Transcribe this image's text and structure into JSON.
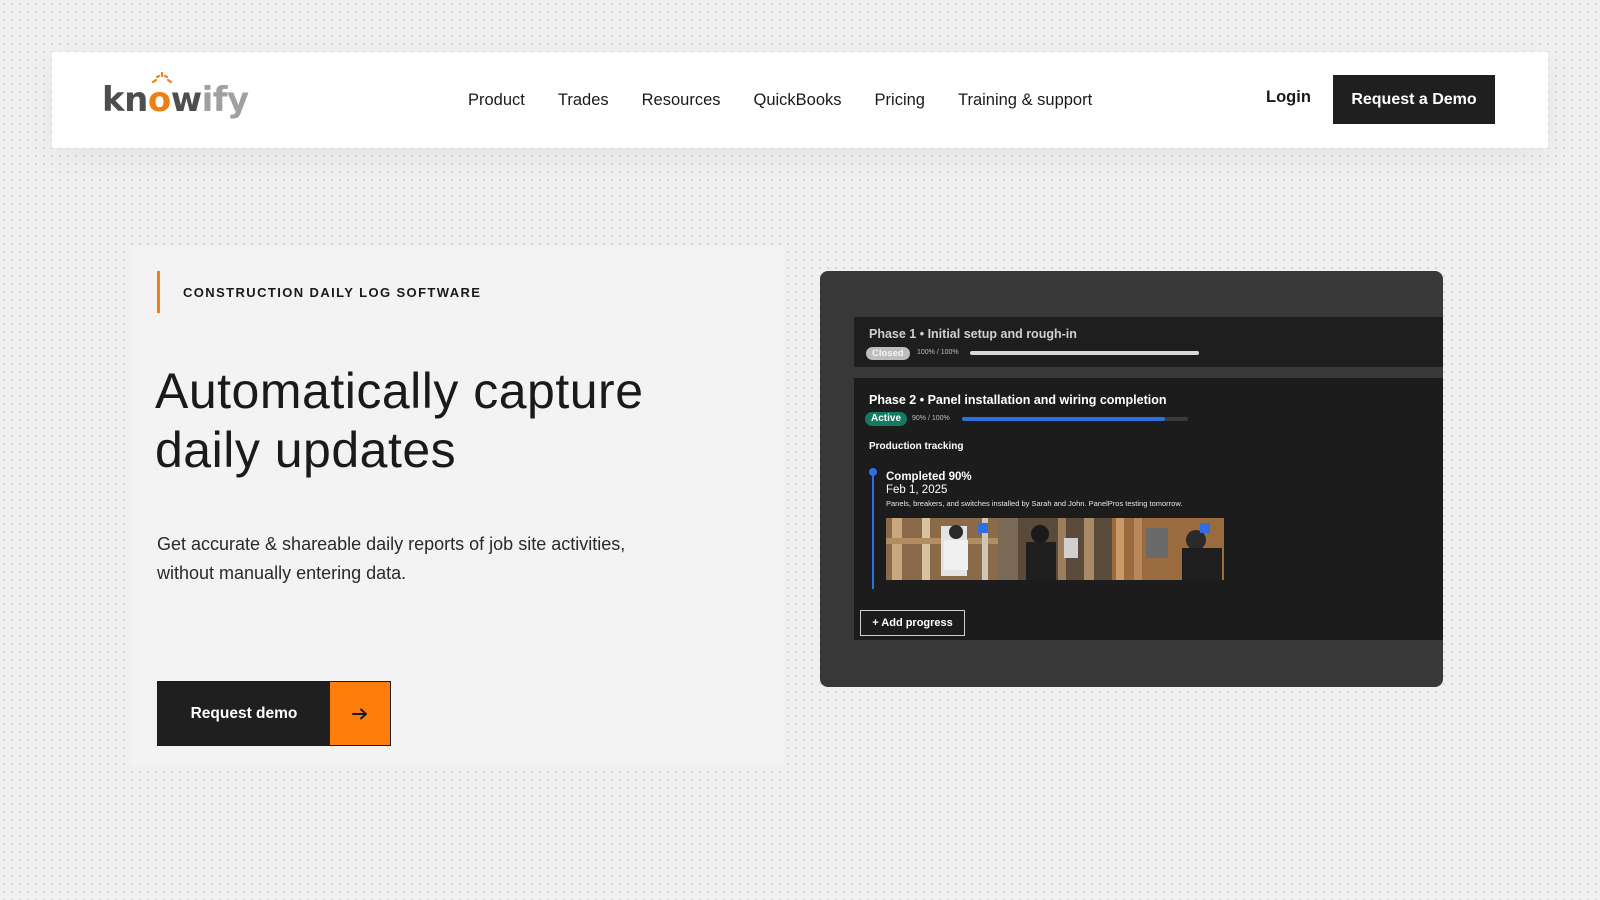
{
  "nav": {
    "logo": {
      "part1": "kn",
      "part2": "o",
      "part3": "w",
      "part4": "ify"
    },
    "links": [
      "Product",
      "Trades",
      "Resources",
      "QuickBooks",
      "Pricing",
      "Training & support"
    ],
    "login": "Login",
    "demo_button": "Request a Demo"
  },
  "hero": {
    "eyebrow": "CONSTRUCTION DAILY LOG SOFTWARE",
    "headline_line1": "Automatically capture",
    "headline_line2": "daily updates",
    "subtext_line1": "Get accurate & shareable daily reports of job site activities,",
    "subtext_line2": "without manually entering data.",
    "cta_label": "Request demo",
    "cta_icon": "arrow-right-icon"
  },
  "mockup": {
    "phase1": {
      "title": "Phase 1 • Initial setup and rough-in",
      "status": "Closed",
      "percent_text": "100% / 100%",
      "progress": 1.0
    },
    "phase2": {
      "title": "Phase 2 • Panel installation and wiring completion",
      "status": "Active",
      "percent_text": "90% / 100%",
      "progress": 0.9,
      "section_label": "Production tracking",
      "entry": {
        "title": "Completed 90%",
        "date": "Feb 1, 2025",
        "note": "Panels, breakers, and switches installed by Sarah and John. PanelPros testing tomorrow."
      },
      "add_button": "+ Add progress"
    }
  },
  "colors": {
    "accent_orange": "#ff7d0a",
    "dark": "#1f1f1f",
    "progress_blue": "#2d6fe3",
    "active_green": "#157a62"
  }
}
